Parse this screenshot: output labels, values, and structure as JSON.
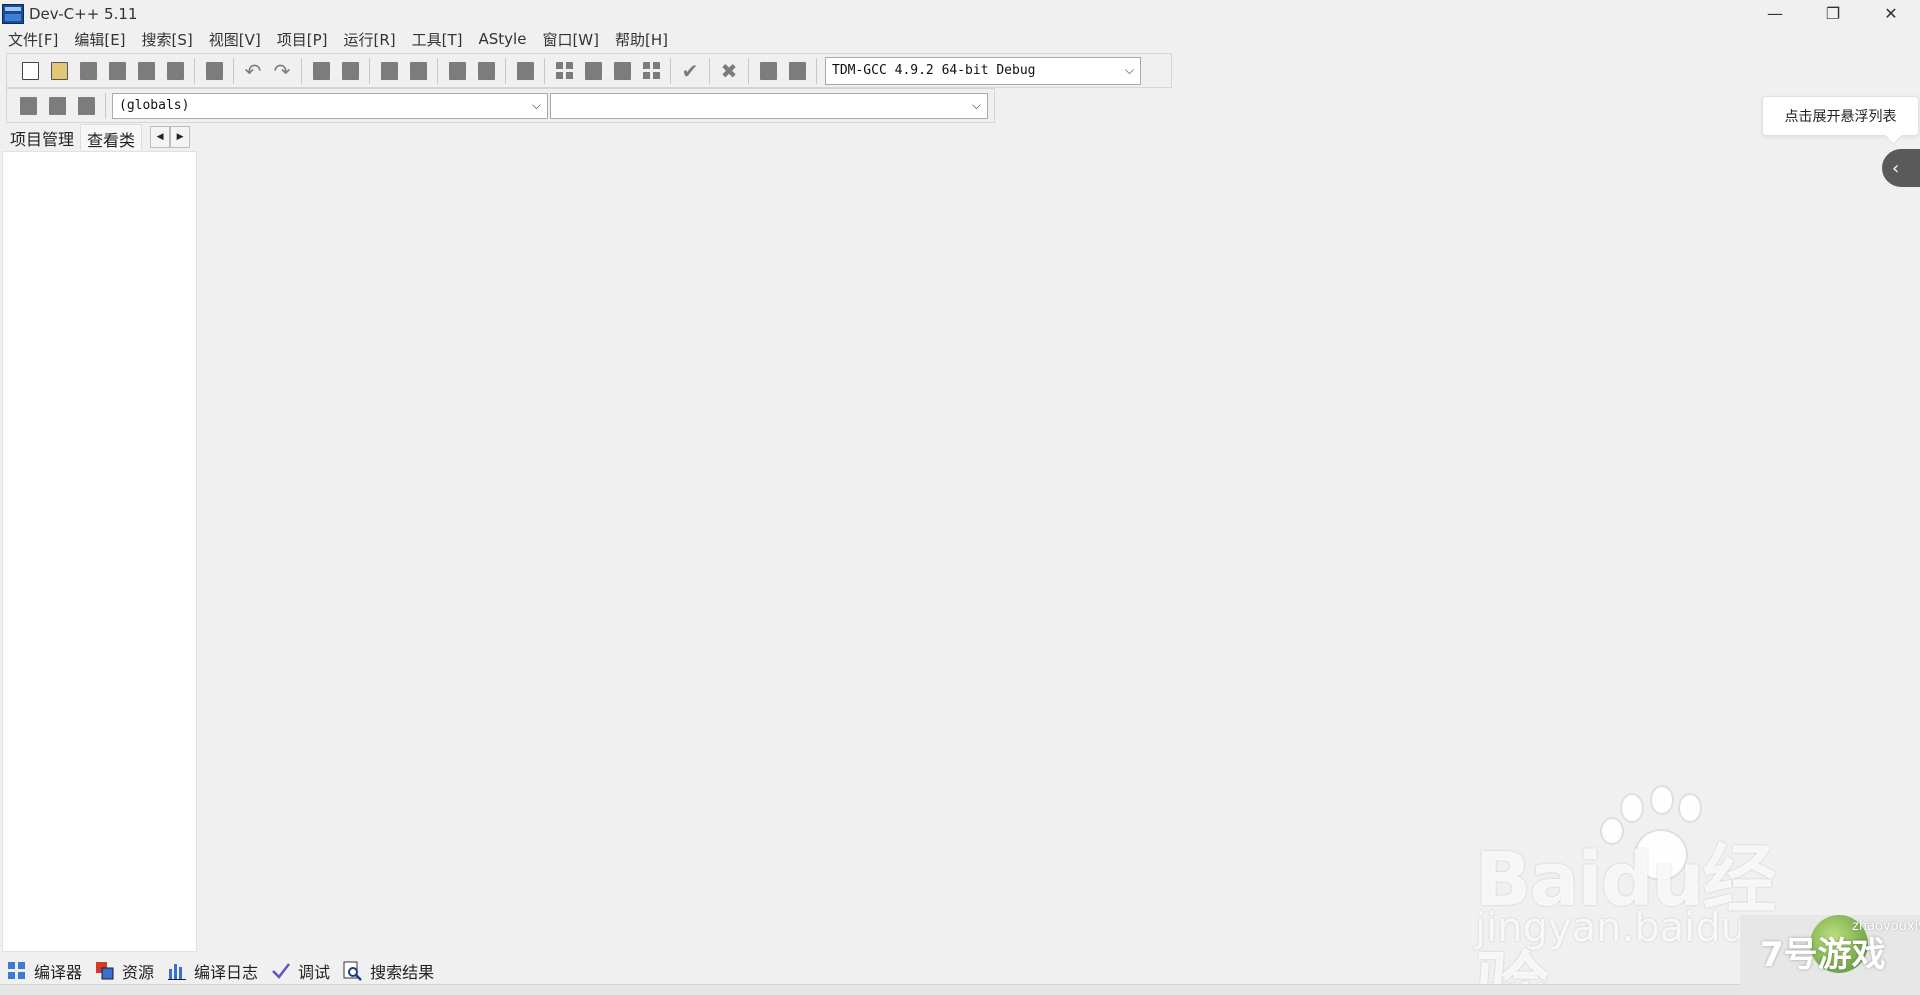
{
  "window": {
    "title": "Dev-C++ 5.11",
    "controls": [
      "minimize-icon",
      "restore-icon",
      "close-icon"
    ]
  },
  "menu": [
    {
      "label": "文件[F]"
    },
    {
      "label": "编辑[E]"
    },
    {
      "label": "搜索[S]"
    },
    {
      "label": "视图[V]"
    },
    {
      "label": "项目[P]"
    },
    {
      "label": "运行[R]"
    },
    {
      "label": "工具[T]"
    },
    {
      "label": "AStyle"
    },
    {
      "label": "窗口[W]"
    },
    {
      "label": "帮助[H]"
    }
  ],
  "toolbar": {
    "compiler_select": "TDM-GCC 4.9.2 64-bit Debug"
  },
  "toolbar2": {
    "class_select": "(globals)",
    "member_select": ""
  },
  "left_tabs": [
    {
      "label": "项目管理"
    },
    {
      "label": "查看类"
    }
  ],
  "bottom_tabs": [
    {
      "label": "编译器",
      "icon": "grid-icon"
    },
    {
      "label": "资源",
      "icon": "resources-icon"
    },
    {
      "label": "编译日志",
      "icon": "chart-icon"
    },
    {
      "label": "调试",
      "icon": "check-icon"
    },
    {
      "label": "搜索结果",
      "icon": "search-icon"
    }
  ],
  "floating": {
    "tooltip": "点击展开悬浮列表",
    "toggle_glyph": "‹"
  },
  "watermarks": {
    "baidu_logo": "Baidu经验",
    "baidu_url": "jingyan.baidu.com",
    "corner_logo": "7号游戏",
    "corner_sub": "zhaoyouxiwang"
  }
}
